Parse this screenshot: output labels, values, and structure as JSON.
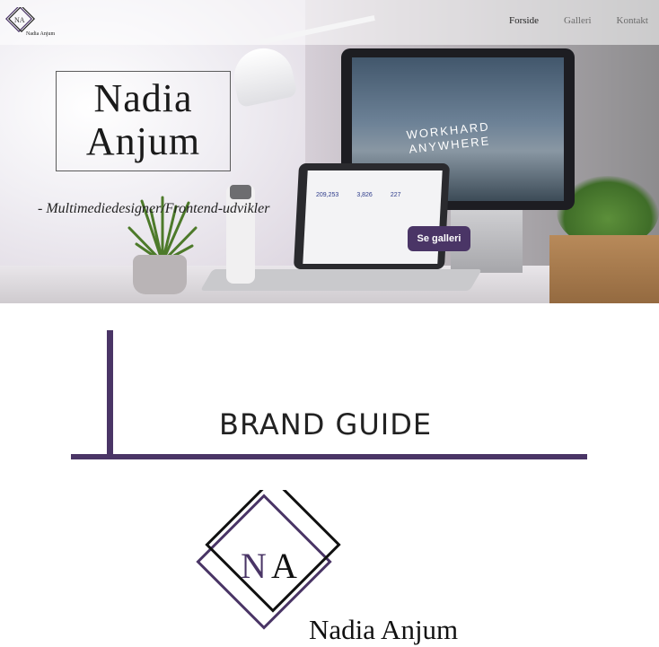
{
  "nav": {
    "logo_initials": "NA",
    "logo_name": "Nadia Anjum",
    "links": [
      "Forside",
      "Galleri",
      "Kontakt"
    ]
  },
  "hero": {
    "name_line1": "Nadia",
    "name_line2": "Anjum",
    "tagline": "- Multimediedesigner/Frontend-udvikler",
    "button_label": "Se galleri",
    "monitor_text_line1": "WORKHARD",
    "monitor_text_line2": "ANYWHERE",
    "laptop_stats": [
      "209,253",
      "3,826",
      "227"
    ]
  },
  "brand_guide": {
    "title": "BRAND GUIDE",
    "logo_initial_1": "N",
    "logo_initial_2": "A",
    "logo_name": "Nadia Anjum"
  },
  "colors": {
    "accent": "#4a3566",
    "text": "#222222"
  }
}
